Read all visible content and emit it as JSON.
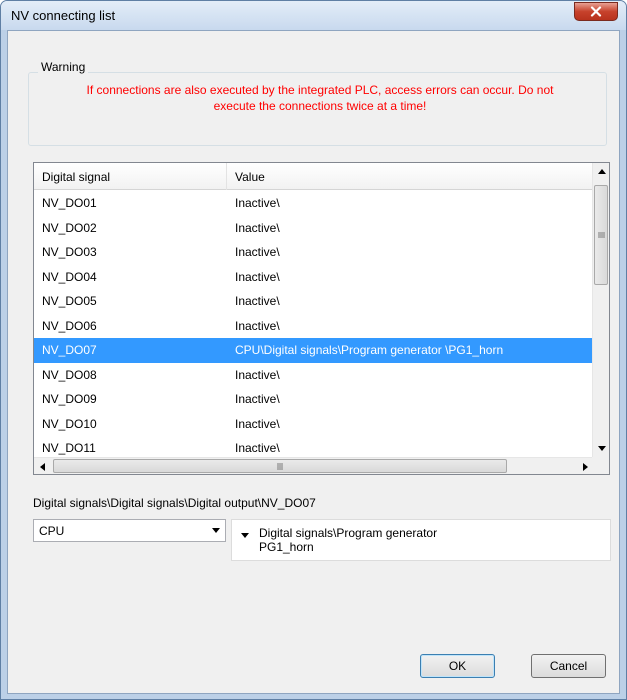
{
  "window": {
    "title": "NV connecting list"
  },
  "warning": {
    "legend": "Warning",
    "line1": "If connections are also executed by the integrated PLC, access errors can occur. Do not",
    "line2": "execute the connections twice at a time!",
    "color": "#ff0000"
  },
  "list": {
    "columns": [
      "Digital signal",
      "Value"
    ],
    "rows": [
      {
        "signal": "NV_DO01",
        "value": "Inactive\\",
        "selected": false
      },
      {
        "signal": "NV_DO02",
        "value": "Inactive\\",
        "selected": false
      },
      {
        "signal": "NV_DO03",
        "value": "Inactive\\",
        "selected": false
      },
      {
        "signal": "NV_DO04",
        "value": "Inactive\\",
        "selected": false
      },
      {
        "signal": "NV_DO05",
        "value": "Inactive\\",
        "selected": false
      },
      {
        "signal": "NV_DO06",
        "value": "Inactive\\",
        "selected": false
      },
      {
        "signal": "NV_DO07",
        "value": "CPU\\Digital signals\\Program generator \\PG1_horn",
        "selected": true
      },
      {
        "signal": "NV_DO08",
        "value": "Inactive\\",
        "selected": false
      },
      {
        "signal": "NV_DO09",
        "value": "Inactive\\",
        "selected": false
      },
      {
        "signal": "NV_DO10",
        "value": "Inactive\\",
        "selected": false
      },
      {
        "signal": "NV_DO11",
        "value": "Inactive\\",
        "selected": false
      }
    ],
    "selection_color": "#3399ff"
  },
  "selection": {
    "path": "Digital signals\\Digital signals\\Digital output\\NV_DO07",
    "source_combo": "CPU",
    "value_line1": "Digital signals\\Program generator",
    "value_line2": "PG1_horn"
  },
  "buttons": {
    "ok": "OK",
    "cancel": "Cancel"
  }
}
